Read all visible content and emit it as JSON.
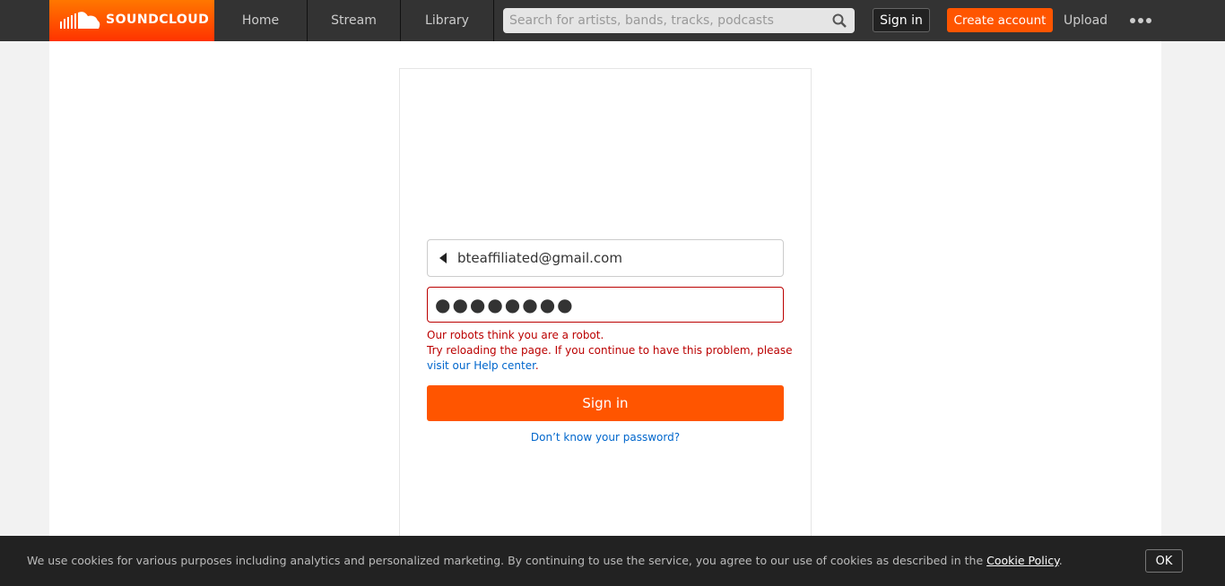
{
  "header": {
    "logo_text": "SOUNDCLOUD",
    "nav": [
      {
        "label": "Home"
      },
      {
        "label": "Stream"
      },
      {
        "label": "Library"
      }
    ],
    "search_placeholder": "Search for artists, bands, tracks, podcasts",
    "sign_in_label": "Sign in",
    "create_account_label": "Create account",
    "upload_label": "Upload",
    "accent_color": "#ff5500"
  },
  "login": {
    "email": "bteaffiliated@gmail.com",
    "password_masked": "●●●●●●●●",
    "error_line1": "Our robots think you are a robot.",
    "error_line2": "Try reloading the page. If you continue to have this problem, please",
    "error_link": "visit our Help center",
    "error_period": ".",
    "submit_label": "Sign in",
    "forgot_label": "Don’t know your password?"
  },
  "cookie": {
    "text": "We use cookies for various purposes including analytics and personalized marketing. By continuing to use the service, you agree to our use of cookies as described in the ",
    "link": "Cookie Policy",
    "period": ".",
    "ok_label": "OK"
  }
}
